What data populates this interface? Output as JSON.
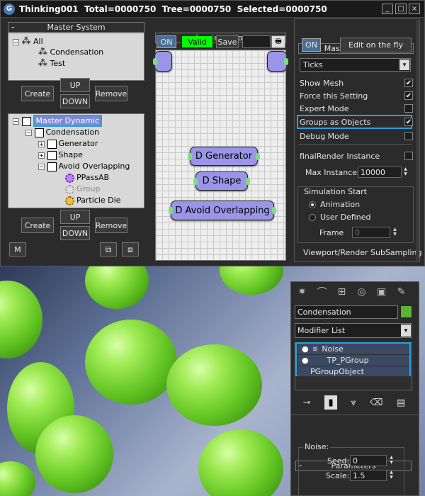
{
  "window": {
    "title": "Thinking001  Total=0000750  Tree=0000750  Selected=0000750",
    "btn_min": "_",
    "btn_max": "□",
    "btn_close": "×"
  },
  "master_system": {
    "header": "Master System",
    "tree": [
      "All",
      "Condensation",
      "Test"
    ],
    "create": "Create",
    "up": "UP",
    "down": "DOWN",
    "remove": "Remove"
  },
  "dynamic_tree": {
    "rows": [
      "Master Dynamic",
      "Condensation",
      "Generator",
      "Shape",
      "Avoid Overlapping",
      "PPassAB",
      "Group",
      "Particle Die"
    ],
    "create": "Create",
    "up": "UP",
    "down": "DOWN",
    "remove": "Remove",
    "m_label": "M"
  },
  "condensation": {
    "header": "Condensation",
    "on": "ON",
    "valid": "Valid",
    "save": "Save",
    "nodes": [
      "D Generator",
      "D Shape",
      "D Avoid Overlapping"
    ]
  },
  "master_dynamic": {
    "header": "Master Dynamic",
    "on": "ON",
    "edit": "Edit on the fly",
    "dropdown": "Ticks",
    "options": [
      {
        "label": "Show Mesh",
        "checked": true
      },
      {
        "label": "Force this Setting",
        "checked": true
      },
      {
        "label": "Expert Mode",
        "checked": false
      },
      {
        "label": "Groups as Objects",
        "checked": true
      },
      {
        "label": "Debug Mode",
        "checked": false
      },
      {
        "label": "finalRender Instance",
        "checked": false
      }
    ],
    "max_instances_label": "Max Instances",
    "max_instances": "10000",
    "sim_start": "Simulation Start",
    "radio_animation": "Animation",
    "radio_user": "User Defined",
    "frame_label": "Frame",
    "frame_value": "0",
    "viewport_sub": "Viewport/Render SubSampling"
  },
  "command_panel": {
    "object_name": "Condensation",
    "modifier_list": "Modifier List",
    "stack": [
      "Noise",
      "TP_PGroup",
      "PGroupObject"
    ],
    "params_header": "Parameters",
    "noise_label": "Noise:",
    "seed_label": "Seed:",
    "seed": "0",
    "scale_label": "Scale:",
    "scale": "1.5"
  },
  "colors": {
    "valid_green": "#00ff00",
    "node_purple": "#9a95e8",
    "highlight_blue": "#2aa0e0",
    "color_swatch": "#5bb530"
  }
}
